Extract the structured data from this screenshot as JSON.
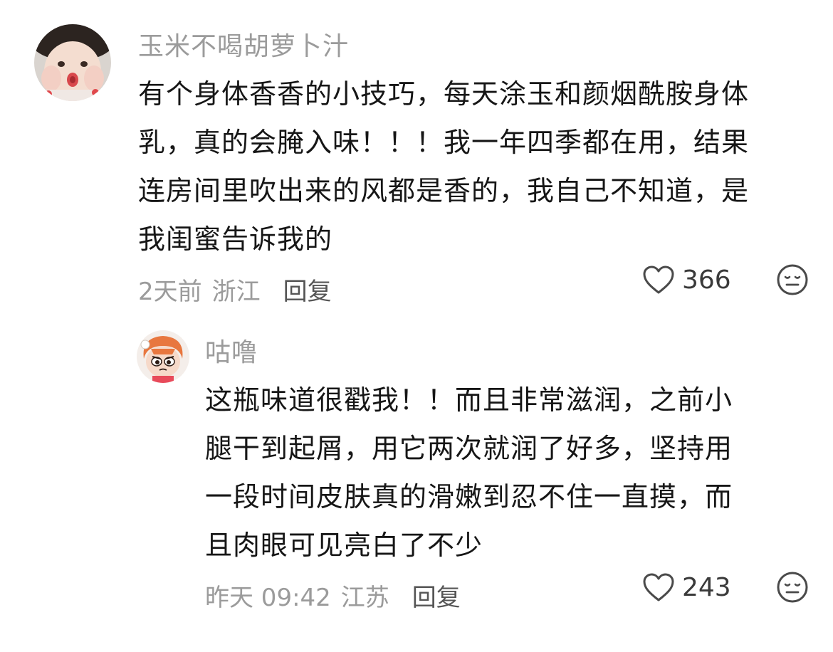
{
  "comments": [
    {
      "username": "玉米不喝胡萝卜汁",
      "text_lines": [
        "有个身体香香的小技巧，每天涂玉和颜烟酰胺身体",
        "乳，真的会腌入味！！！我一年四季都在用，结果",
        "连房间里吹出来的风都是香的，我自己不知道，是",
        "我闺蜜告诉我的"
      ],
      "time": "2天前",
      "location": "浙江",
      "reply_label": "回复",
      "likes": "366",
      "avatar_icon": "baby-avatar",
      "dislike_icon": "dislike-face-icon"
    },
    {
      "username": "咕噜",
      "text_lines": [
        "这瓶味道很戳我！！而且非常滋润，之前小",
        "腿干到起屑，用它两次就润了好多，坚持用",
        "一段时间皮肤真的滑嫩到忍不住一直摸，而",
        "且肉眼可见亮白了不少"
      ],
      "time": "昨天 09:42",
      "location": "江苏",
      "reply_label": "回复",
      "likes": "243",
      "avatar_icon": "cartoon-girl-avatar",
      "dislike_icon": "dislike-face-icon"
    }
  ],
  "colors": {
    "username": "#9b9b9b",
    "text": "#161616",
    "meta": "#9b9b9b",
    "reply": "#555555",
    "icon": "#4a4a4a"
  }
}
